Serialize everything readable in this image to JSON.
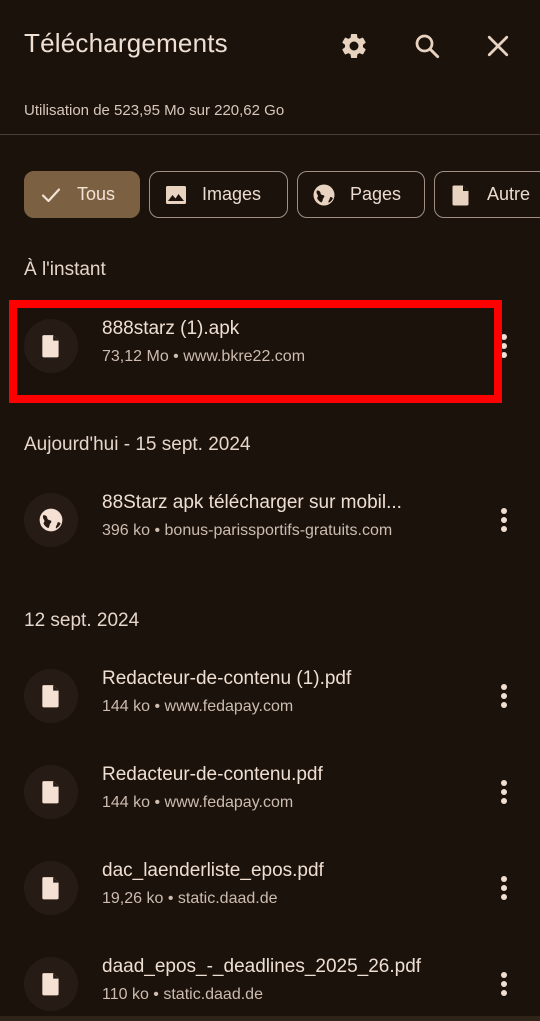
{
  "header": {
    "title": "Téléchargements",
    "settings_icon": "gear-icon",
    "search_icon": "search-icon",
    "close_icon": "close-icon"
  },
  "usage": "Utilisation de 523,95 Mo sur 220,62 Go",
  "filters": [
    {
      "label": "Tous",
      "icon": "check-icon",
      "selected": true
    },
    {
      "label": "Images",
      "icon": "image-icon",
      "selected": false
    },
    {
      "label": "Pages",
      "icon": "globe-icon",
      "selected": false
    },
    {
      "label": "Autre",
      "icon": "file-icon",
      "selected": false
    }
  ],
  "sections": [
    {
      "label": "À l'instant",
      "items": [
        {
          "name": "888starz (1).apk",
          "meta": "73,12 Mo • www.bkre22.com",
          "icon": "file-icon"
        }
      ]
    },
    {
      "label": "Aujourd'hui - 15 sept. 2024",
      "items": [
        {
          "name": "88Starz apk télécharger sur mobil...",
          "meta": "396 ko • bonus-parissportifs-gratuits.com",
          "icon": "globe-icon"
        }
      ]
    },
    {
      "label": "12 sept. 2024",
      "items": [
        {
          "name": "Redacteur-de-contenu (1).pdf",
          "meta": "144 ko • www.fedapay.com",
          "icon": "file-icon"
        },
        {
          "name": "Redacteur-de-contenu.pdf",
          "meta": "144 ko • www.fedapay.com",
          "icon": "file-icon"
        },
        {
          "name": "dac_laenderliste_epos.pdf",
          "meta": "19,26 ko • static.daad.de",
          "icon": "file-icon"
        },
        {
          "name": "daad_epos_-_deadlines_2025_26.pdf",
          "meta": "110 ko • static.daad.de",
          "icon": "file-icon"
        }
      ]
    }
  ],
  "colors": {
    "background": "#1b120c",
    "selected_chip": "#7b6141",
    "highlight": "#ff0000",
    "text": "#efdfd2"
  }
}
